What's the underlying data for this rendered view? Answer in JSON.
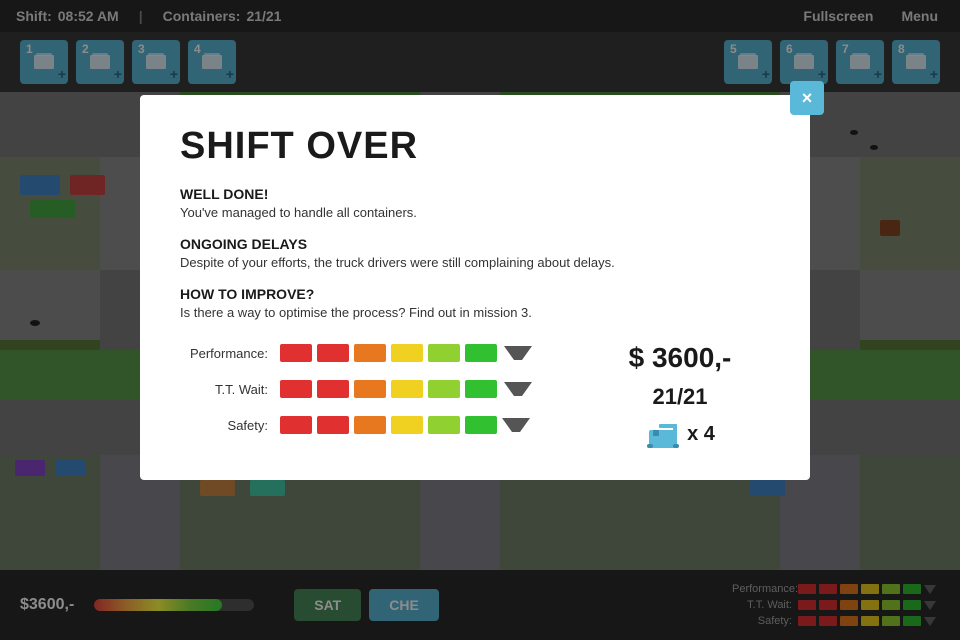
{
  "topbar": {
    "shift_label": "Shift:",
    "shift_time": "08:52 AM",
    "divider": "|",
    "containers_label": "Containers:",
    "containers_value": "21/21",
    "fullscreen_btn": "Fullscreen",
    "menu_btn": "Menu"
  },
  "iconbar": {
    "icons": [
      {
        "num": "1",
        "plus": "+"
      },
      {
        "num": "2",
        "plus": "+"
      },
      {
        "num": "3",
        "plus": "+"
      },
      {
        "num": "4",
        "plus": "+"
      },
      {
        "num": "5",
        "plus": "+"
      },
      {
        "num": "6",
        "plus": "+"
      },
      {
        "num": "7",
        "plus": "+"
      },
      {
        "num": "8",
        "plus": "+"
      }
    ]
  },
  "modal": {
    "title": "SHIFT OVER",
    "close_icon": "×",
    "section1": {
      "heading": "WELL DONE!",
      "body": "You've managed to handle all containers."
    },
    "section2": {
      "heading": "ONGOING DELAYS",
      "body": "Despite of your efforts, the truck drivers were still complaining about delays."
    },
    "section3": {
      "heading": "HOW TO IMPROVE?",
      "body": "Is there a way to optimise the process? Find out in mission 3."
    },
    "stats": {
      "performance_label": "Performance:",
      "tt_wait_label": "T.T. Wait:",
      "safety_label": "Safety:",
      "money": "$ 3600,-",
      "containers": "21/21",
      "crane_count": "x 4"
    }
  },
  "bottom": {
    "score": "$3600,-",
    "progress_pct": 80,
    "sat_btn": "SAT",
    "che_btn": "CHE",
    "mini_stats": {
      "performance_label": "Performance:",
      "tt_wait_label": "T.T. Wait:",
      "safety_label": "Safety:"
    }
  },
  "colors": {
    "bar1": "#e03030",
    "bar2": "#e03030",
    "bar3": "#e87820",
    "bar4": "#f0d020",
    "bar5": "#90d030",
    "bar6": "#30c030",
    "accent": "#5ab8d8",
    "dark": "#2a2a2a"
  }
}
